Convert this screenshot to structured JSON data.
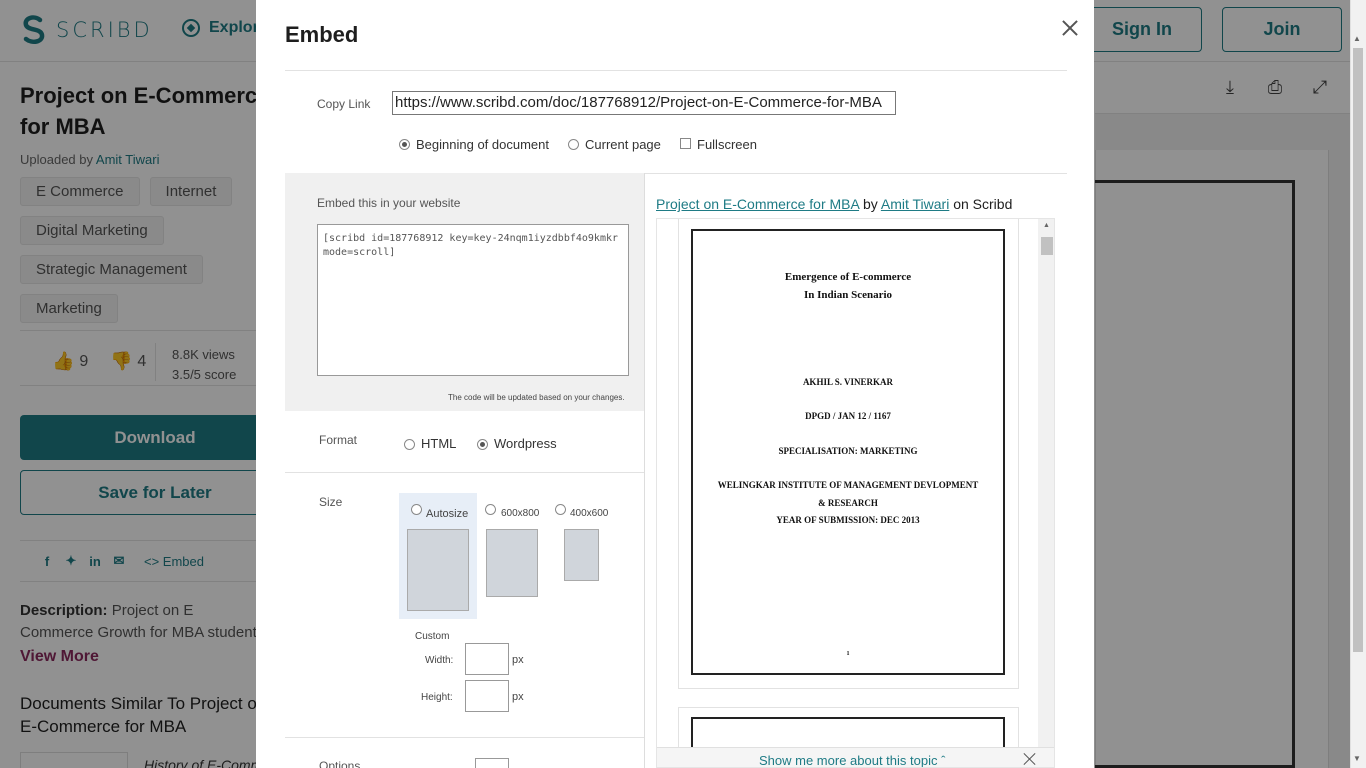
{
  "header": {
    "logo_text": "SCRIBD",
    "explore": "Explore",
    "sign_in": "Sign In",
    "join": "Join"
  },
  "document": {
    "title": "Project on E-Commerce for MBA",
    "uploaded_prefix": "Uploaded by",
    "author": "Amit Tiwari",
    "tags": [
      "E Commerce",
      "Internet",
      "Digital Marketing",
      "Strategic Management",
      "Marketing"
    ],
    "likes": "9",
    "dislikes": "4",
    "views": "8.8K views",
    "score": "3.5/5 score",
    "download": "Download",
    "save_for_later": "Save for Later",
    "embed_link": "Embed",
    "description_label": "Description:",
    "description": "Project on E Commerce Growth for MBA students",
    "view_more": "View More",
    "similar_heading": "Documents Similar To Project on E-Commerce for MBA",
    "similar_first": "History of E-Commerce"
  },
  "modal": {
    "title": "Embed",
    "copy_link_label": "Copy Link",
    "link_value": "https://www.scribd.com/doc/187768912/Project-on-E-Commerce-for-MBA",
    "start_options": [
      {
        "label": "Beginning of document",
        "selected": true
      },
      {
        "label": "Current page",
        "selected": false
      }
    ],
    "fullscreen_label": "Fullscreen",
    "embed_label": "Embed this in your website",
    "embed_code": "[scribd id=187768912 key=key-24nqm1iyzdbbf4o9kmkr mode=scroll]",
    "code_note": "The code will be updated based on your changes.",
    "format_label": "Format",
    "format_html": "HTML",
    "format_wordpress": "Wordpress",
    "size_label": "Size",
    "size_autosize": "Autosize",
    "size_600": "600x800",
    "size_400": "400x600",
    "custom_label": "Custom",
    "width_label": "Width:",
    "height_label": "Height:",
    "px": "px",
    "options_label": "Options"
  },
  "preview": {
    "title_link": "Project on E-Commerce for MBA",
    "by": "by",
    "author_link": "Amit Tiwari",
    "on": "on Scribd",
    "lines": [
      "Emergence of E-commerce",
      "In Indian Scenario",
      "AKHIL S. VINERKAR",
      "DPGD / JAN 12 / 1167",
      "SPECIALISATION: MARKETING",
      "WELINGKAR INSTITUTE OF MANAGEMENT DEVLOPMENT",
      "& RESEARCH",
      "YEAR OF SUBMISSION: DEC 2013",
      "1"
    ],
    "footer": "Show me more about this topic"
  },
  "colors": {
    "accent": "#1e7b85",
    "view_more": "#8c2a5e",
    "overlay": "rgba(0,0,0,0.43)"
  }
}
